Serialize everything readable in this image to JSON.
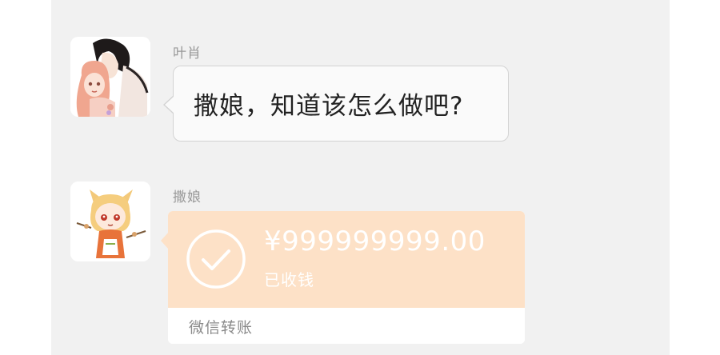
{
  "messages": [
    {
      "sender": "叶肖",
      "avatar_icon": "anime-couple-avatar",
      "type": "text",
      "text": "撒娘，知道该怎么做吧?"
    },
    {
      "sender": "撒娘",
      "avatar_icon": "chibi-fox-girl-avatar",
      "type": "transfer",
      "amount": "¥999999999.00",
      "status": "已收钱",
      "label": "微信转账",
      "icon": "check-circle-icon"
    }
  ],
  "colors": {
    "background": "#f1f1f1",
    "transfer_orange": "#fde1c7",
    "bubble": "#fafafa"
  }
}
